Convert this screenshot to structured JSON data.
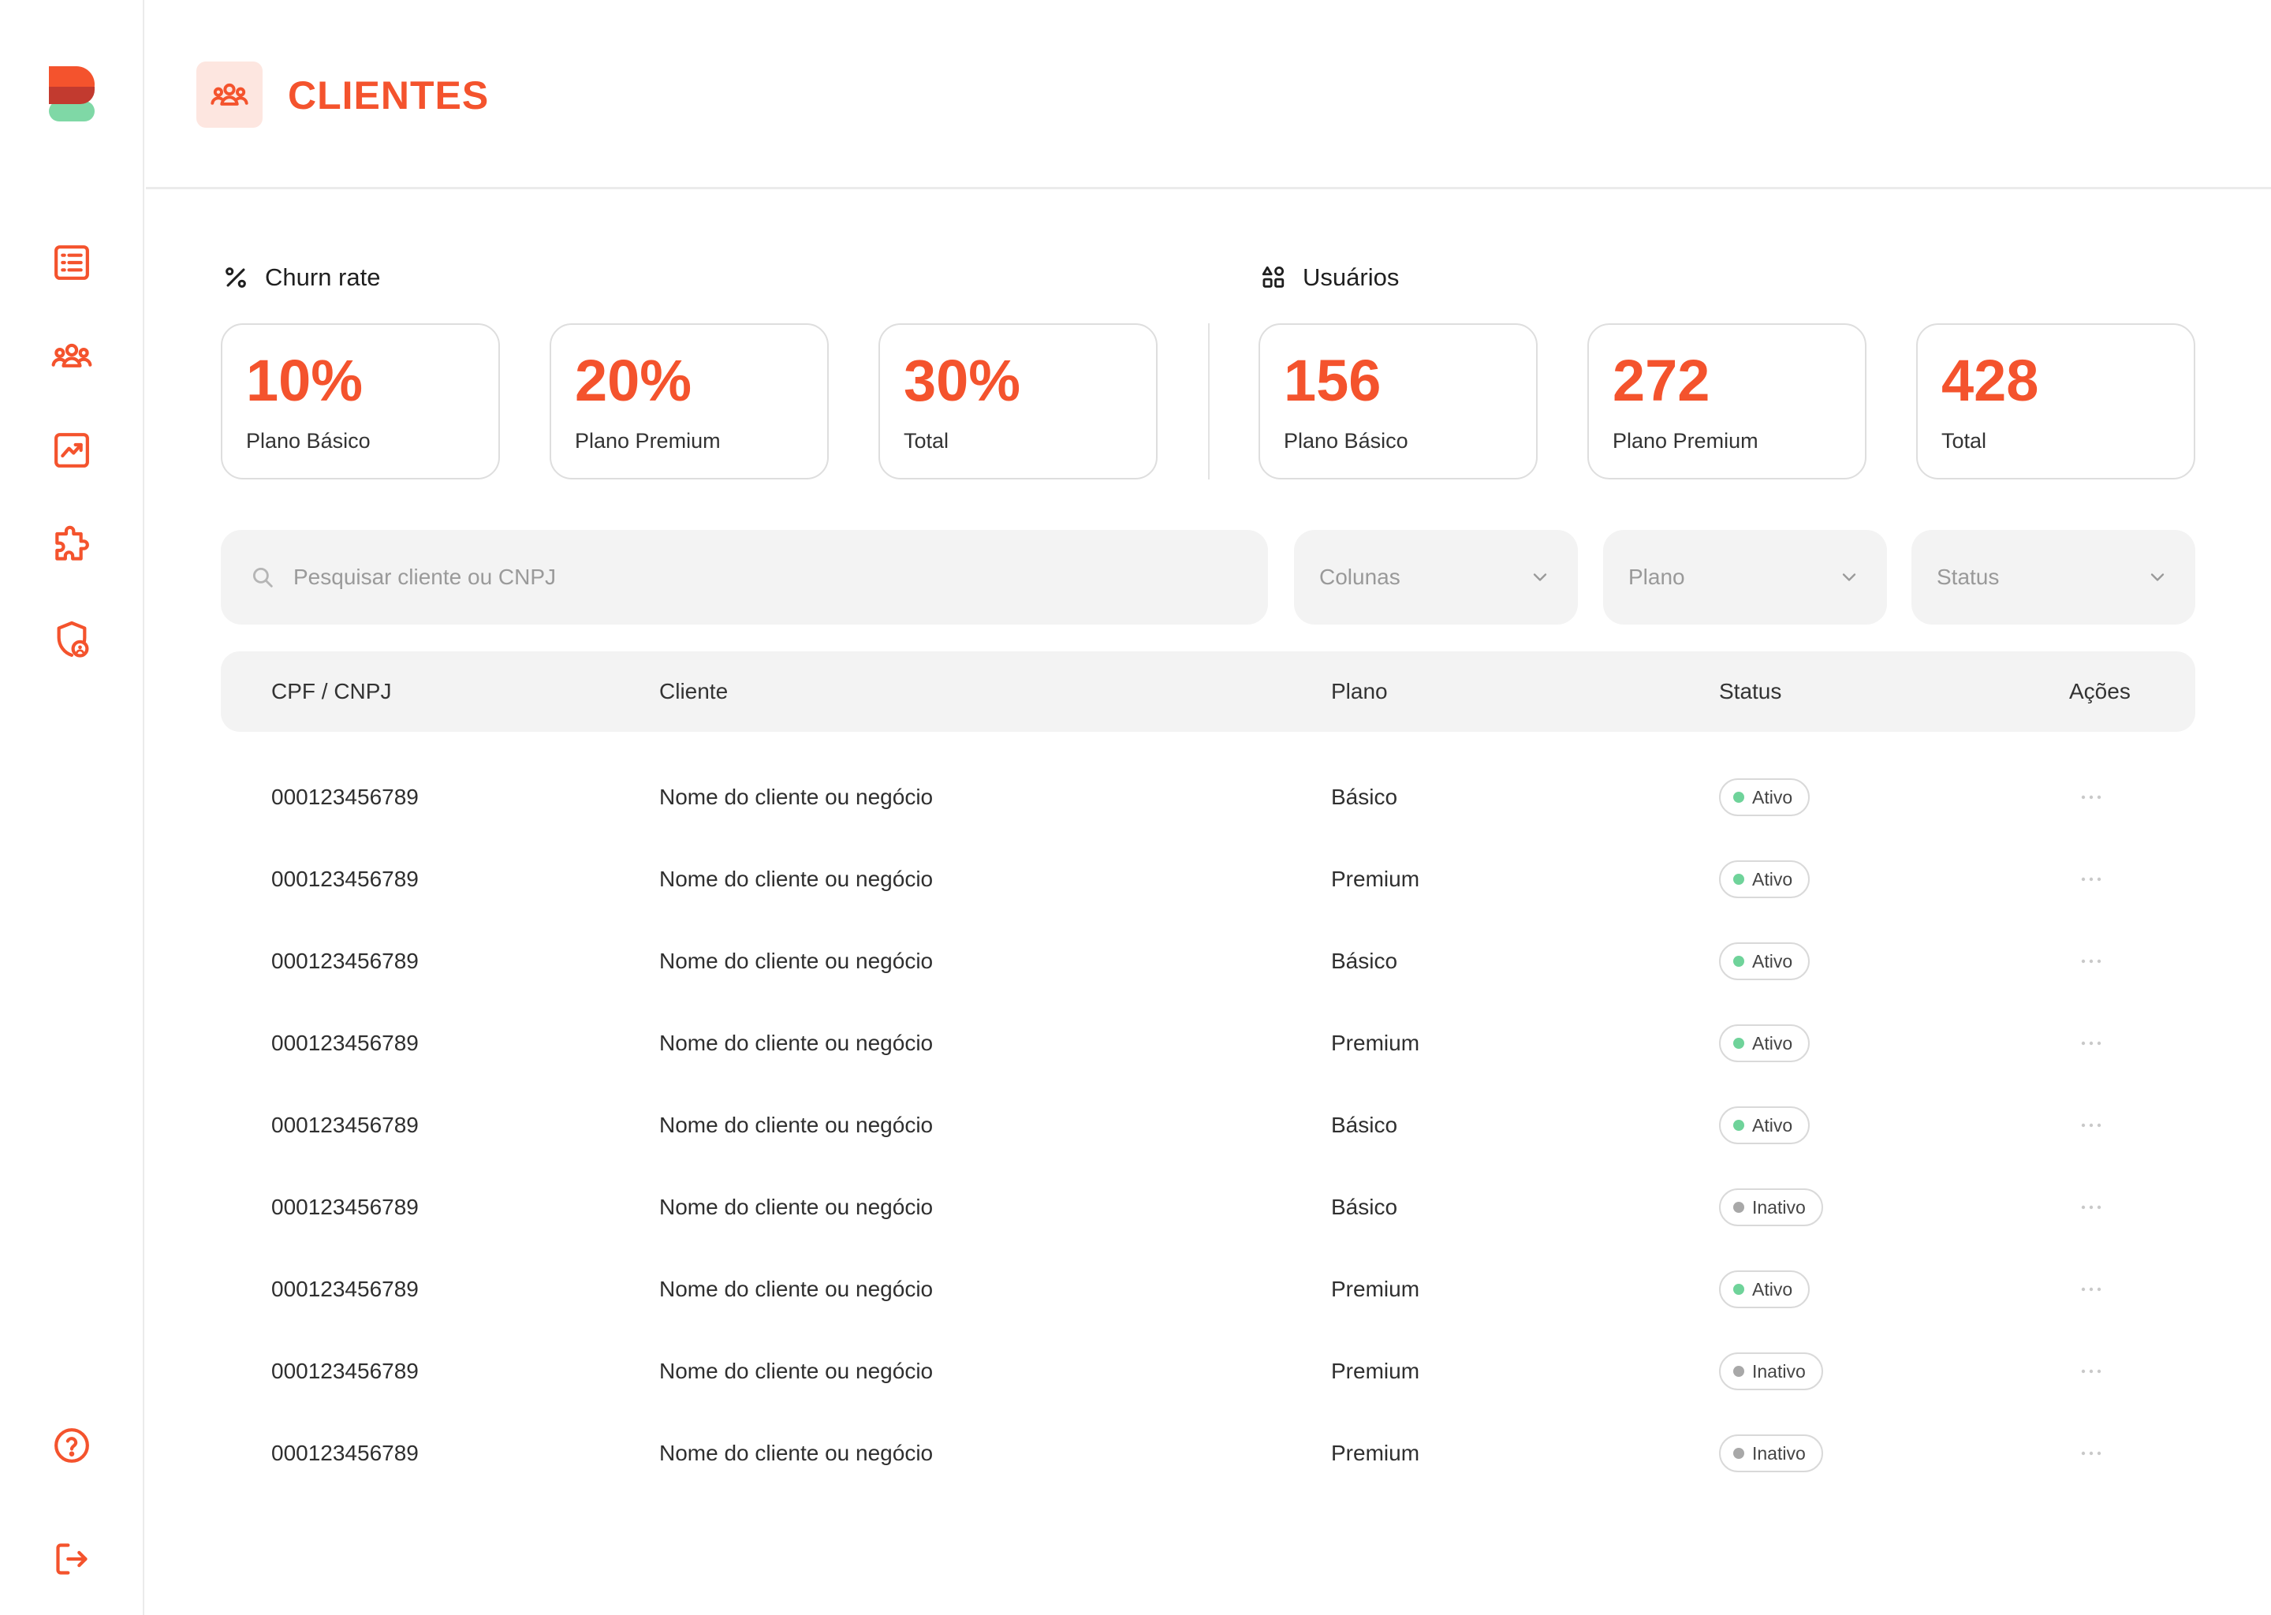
{
  "header": {
    "title": "CLIENTES",
    "icon": "users-group-icon"
  },
  "sidebar": {
    "items": [
      {
        "name": "list-icon"
      },
      {
        "name": "users-icon"
      },
      {
        "name": "chart-icon"
      },
      {
        "name": "puzzle-icon"
      },
      {
        "name": "shield-user-icon"
      }
    ],
    "bottom": [
      {
        "name": "help-icon"
      },
      {
        "name": "logout-icon"
      }
    ]
  },
  "churn": {
    "title": "Churn rate",
    "cards": [
      {
        "value": "10%",
        "label": "Plano Básico"
      },
      {
        "value": "20%",
        "label": "Plano Premium"
      },
      {
        "value": "30%",
        "label": "Total"
      }
    ]
  },
  "users": {
    "title": "Usuários",
    "cards": [
      {
        "value": "156",
        "label": "Plano Básico"
      },
      {
        "value": "272",
        "label": "Plano Premium"
      },
      {
        "value": "428",
        "label": "Total"
      }
    ]
  },
  "filters": {
    "search_placeholder": "Pesquisar cliente ou CNPJ",
    "columns": "Colunas",
    "plan": "Plano",
    "status": "Status"
  },
  "table": {
    "headers": {
      "doc": "CPF / CNPJ",
      "client": "Cliente",
      "plan": "Plano",
      "status": "Status",
      "actions": "Ações"
    },
    "rows": [
      {
        "doc": "000123456789",
        "client": "Nome do cliente ou negócio",
        "plan": "Básico",
        "status": "Ativo"
      },
      {
        "doc": "000123456789",
        "client": "Nome do cliente ou negócio",
        "plan": "Premium",
        "status": "Ativo"
      },
      {
        "doc": "000123456789",
        "client": "Nome do cliente ou negócio",
        "plan": "Básico",
        "status": "Ativo"
      },
      {
        "doc": "000123456789",
        "client": "Nome do cliente ou negócio",
        "plan": "Premium",
        "status": "Ativo"
      },
      {
        "doc": "000123456789",
        "client": "Nome do cliente ou negócio",
        "plan": "Básico",
        "status": "Ativo"
      },
      {
        "doc": "000123456789",
        "client": "Nome do cliente ou negócio",
        "plan": "Básico",
        "status": "Inativo"
      },
      {
        "doc": "000123456789",
        "client": "Nome do cliente ou negócio",
        "plan": "Premium",
        "status": "Ativo"
      },
      {
        "doc": "000123456789",
        "client": "Nome do cliente ou negócio",
        "plan": "Premium",
        "status": "Inativo"
      },
      {
        "doc": "000123456789",
        "client": "Nome do cliente ou negócio",
        "plan": "Premium",
        "status": "Inativo"
      }
    ]
  },
  "colors": {
    "accent": "#f4532d",
    "active": "#6fd39a",
    "inactive": "#a8a8a8"
  }
}
